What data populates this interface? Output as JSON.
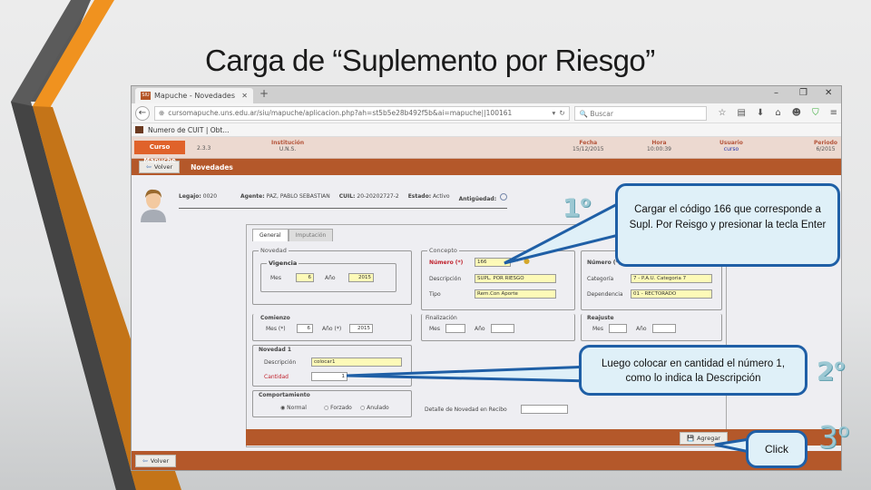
{
  "slide": {
    "title": "Carga de “Suplemento por Riesgo”"
  },
  "browser": {
    "tab_title": "Mapuche - Novedades",
    "favicon_text": "SIU",
    "url": "cursomapuche.uns.edu.ar/siu/mapuche/aplicacion.php?ah=st5b5e28b492f5b&ai=mapuche||100161",
    "search_placeholder": "Buscar",
    "bookmark": "Numero de CUIT | Obt...",
    "window_controls": [
      "–",
      "❐",
      "✕"
    ]
  },
  "app_header": {
    "logo": "Curso Mapuche",
    "version": "2.3.3",
    "columns": [
      {
        "key": "Institución",
        "value": "U.N.S."
      },
      {
        "key": "Fecha",
        "value": "15/12/2015"
      },
      {
        "key": "Hora",
        "value": "10:00:39"
      },
      {
        "key": "Usuario",
        "value": "curso"
      },
      {
        "key": "Periodo",
        "value": "6/2015"
      }
    ]
  },
  "toolbar": {
    "back_label": "Volver",
    "title": "Novedades"
  },
  "agent": {
    "legajo_label": "Legajo:",
    "legajo": "0020",
    "agente_label": "Agente:",
    "agente": "PAZ, PABLO SEBASTIAN",
    "cuil_label": "CUIL:",
    "cuil": "20-20202727-2",
    "estado_label": "Estado:",
    "estado": "Activo",
    "antiguedad_label": "Antigüedad:"
  },
  "form": {
    "tabs": [
      {
        "label": "General",
        "active": true
      },
      {
        "label": "Imputación",
        "active": false
      }
    ],
    "novedad": {
      "legend": "Novedad",
      "vigencia": {
        "legend": "Vigencia",
        "mes_label": "Mes",
        "mes": "6",
        "anio_label": "Año",
        "anio": "2015"
      }
    },
    "concepto": {
      "legend": "Concepto",
      "numero_label": "Número (*)",
      "numero": "166",
      "descripcion_label": "Descripción",
      "descripcion": "SUPL. POR RIESGO",
      "tipo_label": "Tipo",
      "tipo": "Rem.Con Aporte"
    },
    "cargo": {
      "numero_label": "Número (*)",
      "categoria_label": "Categoría",
      "categoria": "7 - P.A.U. Categoria 7",
      "dependencia_label": "Dependencia",
      "dependencia": "01 - RECTORADO"
    },
    "comienzo": {
      "legend": "Comienzo",
      "mes_label": "Mes (*)",
      "mes": "6",
      "anio_label": "Año (*)",
      "anio": "2015"
    },
    "finalizacion": {
      "legend": "Finalización",
      "mes_label": "Mes",
      "anio_label": "Año"
    },
    "reajuste": {
      "legend": "Reajuste",
      "mes_label": "Mes",
      "anio_label": "Año"
    },
    "novedad1": {
      "legend": "Novedad 1",
      "descripcion_label": "Descripción",
      "descripcion": "colocar1",
      "cantidad_label": "Cantidad",
      "cantidad": "1"
    },
    "comportamiento": {
      "legend": "Comportamiento",
      "options": [
        "Normal",
        "Forzado",
        "Anulado"
      ],
      "selected": "Normal"
    },
    "detalle_label": "Detalle de Novedad en Recibo",
    "add_label": "Agregar"
  },
  "footer": {
    "back_label": "Volver"
  },
  "annotations": {
    "callout1": "Cargar el código 166 que corresponde a Supl. Por Reisgo y presionar la tecla Enter",
    "callout2": "Luego colocar en cantidad el número 1, como lo indica la Descripción",
    "callout3": "Click",
    "step1": "1",
    "step2": "2",
    "step3": "3",
    "ordinal": "o"
  },
  "colors": {
    "brand": "#b4582a",
    "logo": "#e0622a",
    "callout_border": "#1f5fa6",
    "callout_bg": "#dff0f8",
    "step": "#9cc8d3",
    "required": "#c0232e",
    "input_yellow": "#fdfab8"
  }
}
